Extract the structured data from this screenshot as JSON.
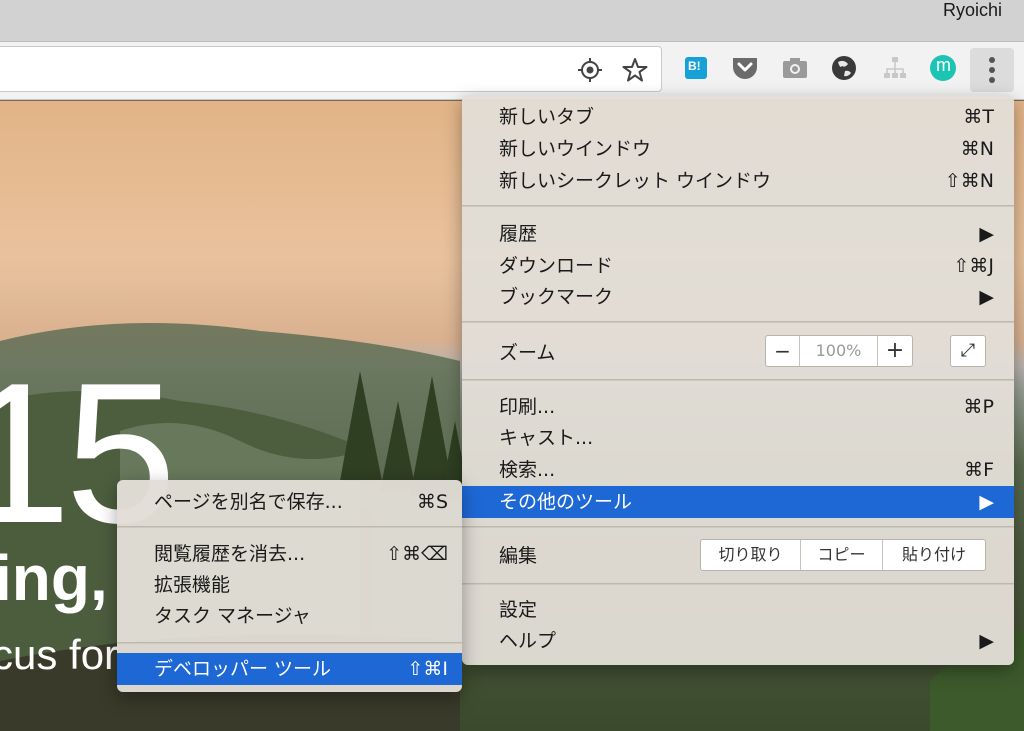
{
  "system_bar": {
    "user_name": "Ryoichi"
  },
  "toolbar": {
    "omnibox_icons": [
      "location-target-icon",
      "star-icon"
    ],
    "extensions": [
      "hatena-bookmark-icon",
      "pocket-icon",
      "camera-icon",
      "globe-icon",
      "sitemap-icon",
      "m-avatar-icon"
    ],
    "hatena_label": "B!",
    "m_label": "m"
  },
  "page": {
    "big_number": "15",
    "tagline_1": "ing,",
    "tagline_2": "cus for"
  },
  "main_menu": {
    "new_tab": {
      "label": "新しいタブ",
      "shortcut": "⌘T"
    },
    "new_window": {
      "label": "新しいウインドウ",
      "shortcut": "⌘N"
    },
    "new_incognito": {
      "label": "新しいシークレット ウインドウ",
      "shortcut": "⇧⌘N"
    },
    "history": {
      "label": "履歴",
      "arrow": "▶"
    },
    "downloads": {
      "label": "ダウンロード",
      "shortcut": "⇧⌘J"
    },
    "bookmarks": {
      "label": "ブックマーク",
      "arrow": "▶"
    },
    "zoom": {
      "label": "ズーム",
      "minus": "−",
      "value": "100%",
      "plus": "+",
      "fullscreen": "⤢"
    },
    "print": {
      "label": "印刷...",
      "shortcut": "⌘P"
    },
    "cast": {
      "label": "キャスト..."
    },
    "find": {
      "label": "検索...",
      "shortcut": "⌘F"
    },
    "more_tools": {
      "label": "その他のツール",
      "arrow": "▶"
    },
    "edit": {
      "label": "編集",
      "cut": "切り取り",
      "copy": "コピー",
      "paste": "貼り付け"
    },
    "settings": {
      "label": "設定"
    },
    "help": {
      "label": "ヘルプ",
      "arrow": "▶"
    }
  },
  "sub_menu": {
    "save_page": {
      "label": "ページを別名で保存...",
      "shortcut": "⌘S"
    },
    "clear_data": {
      "label": "閲覧履歴を消去...",
      "shortcut": "⇧⌘⌫"
    },
    "extensions": {
      "label": "拡張機能"
    },
    "task_manager": {
      "label": "タスク マネージャ"
    },
    "dev_tools": {
      "label": "デベロッパー ツール",
      "shortcut": "⇧⌘I"
    }
  },
  "colors": {
    "highlight": "#1e68d6",
    "menu_bg": "#e2ded6",
    "hatena_blue": "#16a0d8",
    "m_avatar": "#1cc4b4"
  }
}
